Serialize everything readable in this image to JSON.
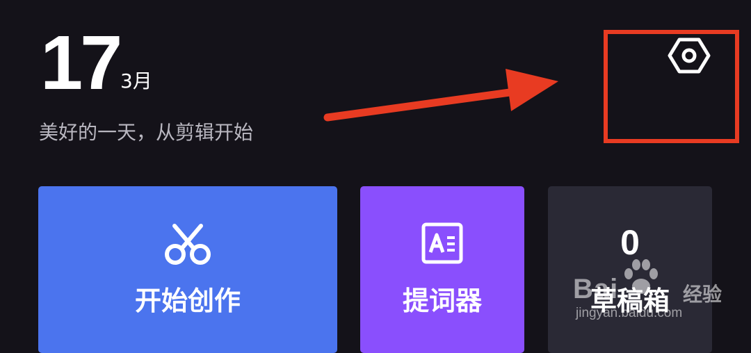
{
  "header": {
    "day": "17",
    "month": "3月",
    "greeting": "美好的一天，从剪辑开始"
  },
  "settings": {
    "icon": "settings-hexagon-icon"
  },
  "cards": {
    "create": {
      "label": "开始创作",
      "icon": "scissors-icon",
      "color": "#4b74ee"
    },
    "prompter": {
      "label": "提词器",
      "icon": "teleprompter-icon",
      "color": "#8a4ffd"
    },
    "drafts": {
      "label": "草稿箱",
      "count": "0",
      "color": "#2a2935"
    }
  },
  "annotation": {
    "color": "#e83b22"
  },
  "watermark": {
    "brand": "Bai",
    "brand_cn": "经验",
    "url": "jingyan.baidu.com"
  }
}
